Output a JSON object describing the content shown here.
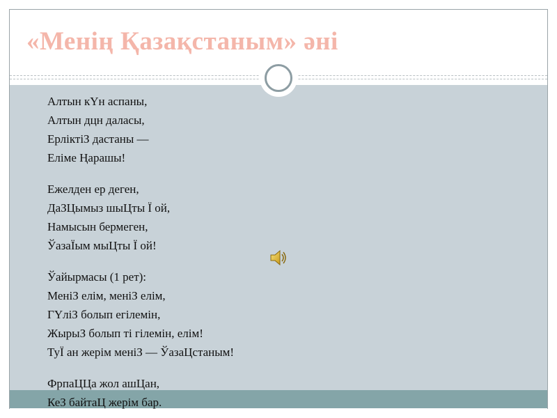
{
  "slide": {
    "title": "«Менің Қазақстаным» әні"
  },
  "lyrics": {
    "stanza1": [
      "Алтын кҮн аспаны,",
      "Алтын дцн даласы,",
      "ЕрліктіЗ дастаны —",
      "Еліме Ңарашы!"
    ],
    "stanza2": [
      "Ежелден ер деген,",
      "ДаЗЦымыз шыЦты Ї ой,",
      "Намысын бермеген,",
      "ЎазаЇым мыЦты Ї ой!"
    ],
    "chorus": [
      "Ўайырмасы (1 рет):",
      "МеніЗ елім, меніЗ елім,",
      "ГҮліЗ болып егілемін,",
      "ЖырыЗ болып ті гілемін, елім!",
      "ТуЇ ан жерім меніЗ — ЎазаЦстаным!"
    ],
    "stanza3": [
      "ФрпаЦЦа жол ашЦан,",
      "КеЗ байтаЦ жерім бар."
    ]
  },
  "icons": {
    "speaker": "speaker-icon",
    "circle": "circle-ornament-icon"
  },
  "colors": {
    "title": "#f4b6aa",
    "content_bg": "#c8d2d8",
    "band": "#84a5a8",
    "ring": "#8d9da3"
  }
}
